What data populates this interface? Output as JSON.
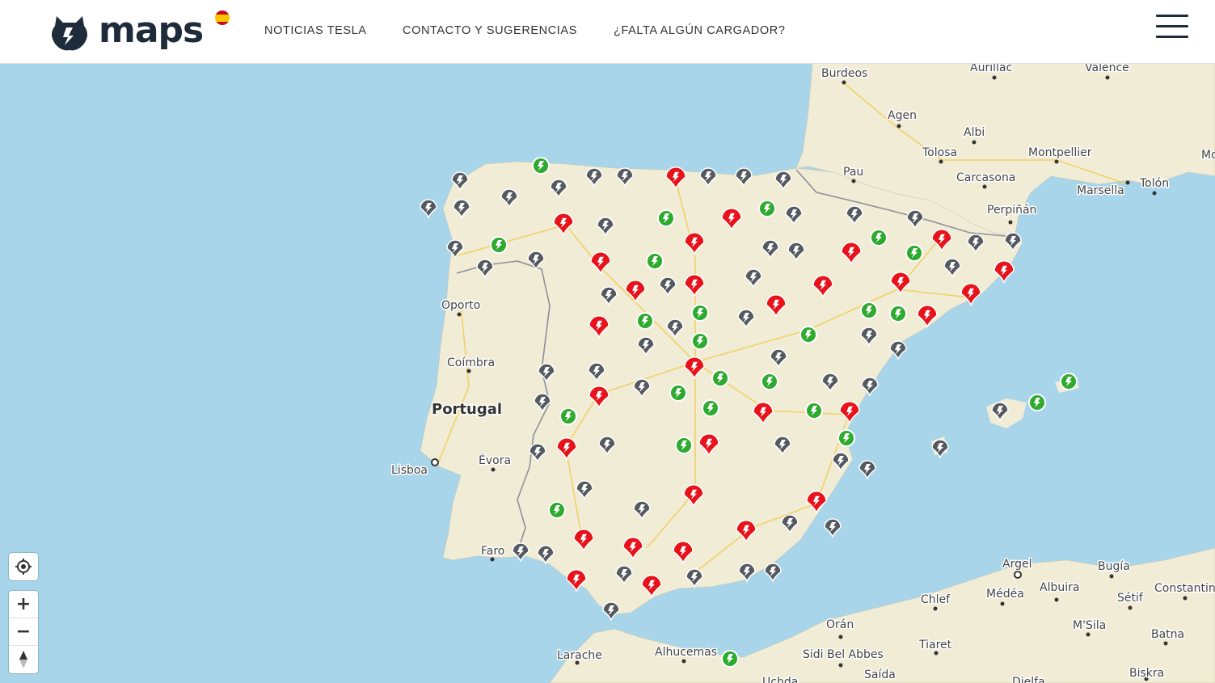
{
  "header": {
    "logo_text": "maps",
    "nav": [
      {
        "label": "NOTICIAS TESLA"
      },
      {
        "label": "CONTACTO Y SUGERENCIAS"
      },
      {
        "label": "¿FALTA ALGÚN CARGADOR?"
      }
    ]
  },
  "map": {
    "colors": {
      "sea": "#a8d5ea",
      "land": "#f0ecd6",
      "accent_red": "#e8121b",
      "accent_green": "#2eaa2e",
      "accent_gray": "#555a60"
    },
    "labels": {
      "cities": [
        "Burdeos",
        "Aurillac",
        "Valence",
        "Agen",
        "Albi",
        "Tolosa",
        "Montpellier",
        "Pau",
        "Carcasona",
        "Marsella",
        "Tolón",
        "Perpiñán",
        "Oporto",
        "Coímbra",
        "Lisboa",
        "Évora",
        "Faro",
        "Argel",
        "Bugía",
        "Constantina",
        "Médéa",
        "Albuira",
        "Chlef",
        "Sétif",
        "M'Sila",
        "Batna",
        "Orán",
        "Sidi Bel Abbes",
        "Tiaret",
        "Saída",
        "Biskra",
        "Larache",
        "Alhucemas",
        "Uchda",
        "Djelfa",
        "Mo"
      ],
      "country": "Portugal"
    }
  },
  "controls": {
    "locate": "locate-icon",
    "zoom_in": "+",
    "zoom_out": "−",
    "compass": "compass-icon"
  }
}
